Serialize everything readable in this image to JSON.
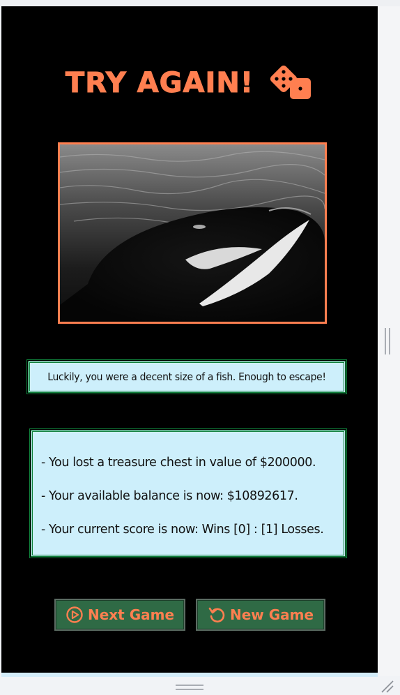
{
  "game": {
    "title": "TRY AGAIN!",
    "title_icon": "dice-icon",
    "image_alt": "orca-photo",
    "message": "Luckily, you were a decent size of a fish. Enough to escape!",
    "results": [
      "- You lost a treasure chest in value of $200000.",
      "- Your available balance is now: $10892617.",
      "- Your current score is now: Wins [0] : [1] Losses."
    ]
  },
  "buttons": {
    "next_label": "Next Game",
    "next_icon": "play-circle-icon",
    "new_label": "New Game",
    "new_icon": "rotate-icon"
  },
  "colors": {
    "accent": "#ff7f50",
    "background": "#000000",
    "panel": "#cdeffb",
    "panel_border": "#0f7f3a",
    "button_bg": "#2f6a45"
  }
}
